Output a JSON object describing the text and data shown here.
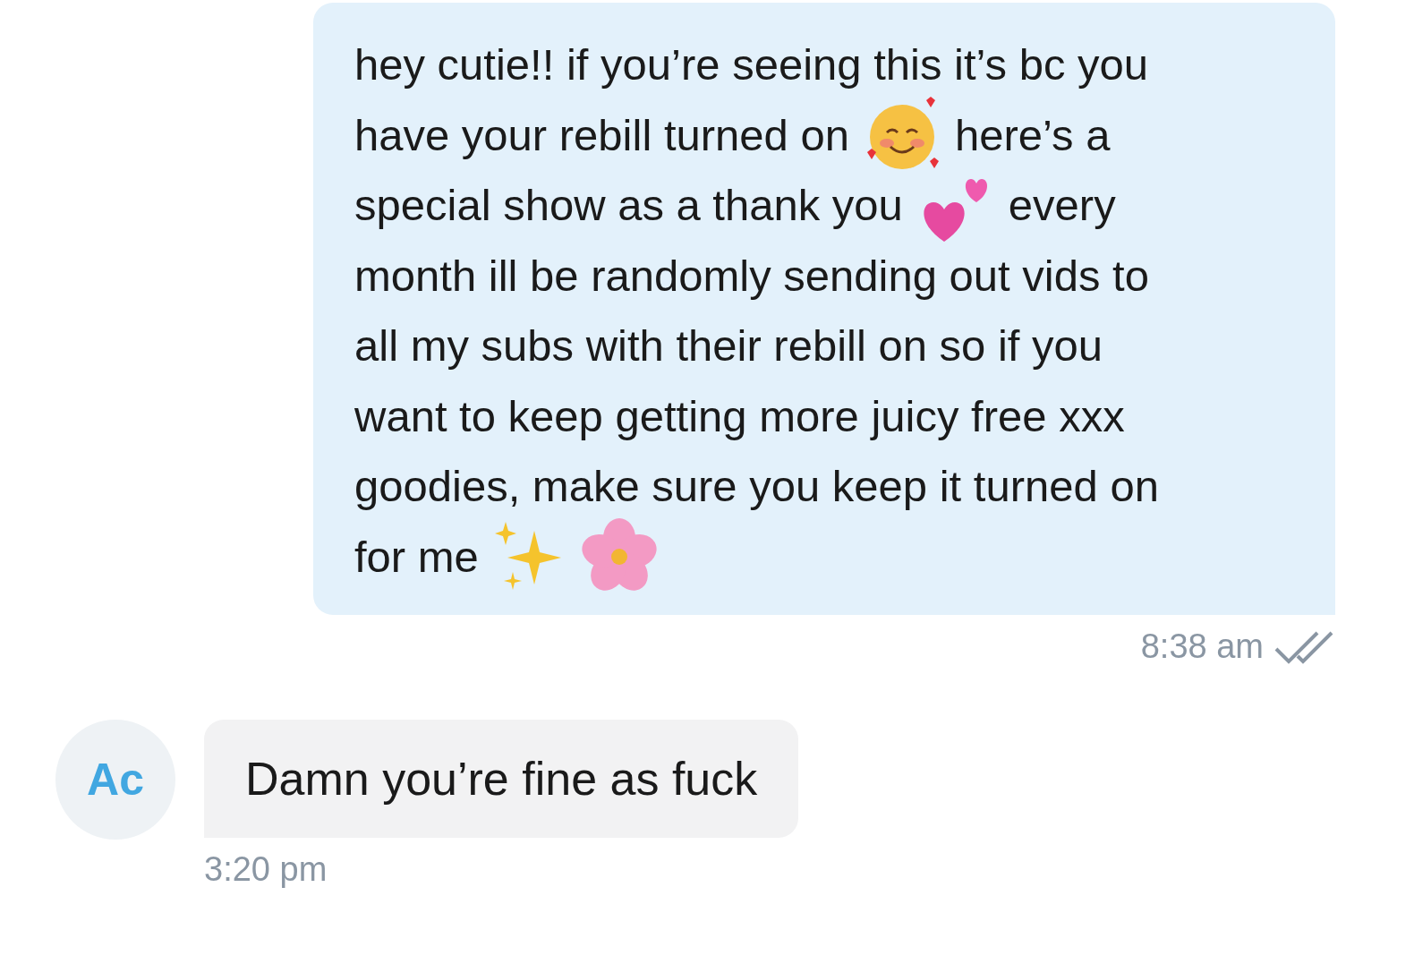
{
  "outgoing": {
    "lines": [
      [
        {
          "kind": "text",
          "text": "hey cutie!! if you’re seeing this it’s bc you"
        }
      ],
      [
        {
          "kind": "text",
          "text": "have your rebill turned on"
        },
        {
          "kind": "blush"
        },
        {
          "kind": "text",
          "text": "here’s a"
        }
      ],
      [
        {
          "kind": "text",
          "text": "special show as a thank you"
        },
        {
          "kind": "hearts"
        },
        {
          "kind": "text",
          "text": "every"
        }
      ],
      [
        {
          "kind": "text",
          "text": "month ill be randomly sending out vids to"
        }
      ],
      [
        {
          "kind": "text",
          "text": "all my subs with their rebill on so if you"
        }
      ],
      [
        {
          "kind": "text",
          "text": "want to keep getting more juicy free xxx"
        }
      ],
      [
        {
          "kind": "text",
          "text": "goodies, make sure you keep it turned on"
        }
      ],
      [
        {
          "kind": "text",
          "text": "for me"
        },
        {
          "kind": "sparkles"
        },
        {
          "kind": "blossom"
        }
      ]
    ],
    "time": "8:38 am",
    "read": true
  },
  "incoming": {
    "avatar": "Ac",
    "text": "Damn you’re fine as fuck",
    "time": "3:20 pm"
  }
}
